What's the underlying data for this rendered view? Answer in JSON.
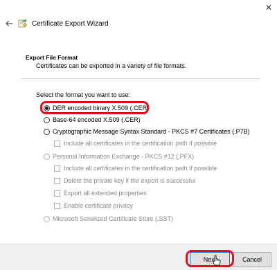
{
  "window": {
    "close_glyph": "✕"
  },
  "titlebar": {
    "back_icon": "back-arrow-icon",
    "title": "Certificate Export Wizard"
  },
  "header": {
    "section_title": "Export File Format",
    "description": "Certificates can be exported in a variety of file formats."
  },
  "form": {
    "prompt": "Select the format you want to use:",
    "options": [
      {
        "label": "DER encoded binary X.509 (.CER)",
        "selected": true,
        "enabled": true
      },
      {
        "label": "Base-64 encoded X.509 (.CER)",
        "selected": false,
        "enabled": true
      },
      {
        "label": "Cryptographic Message Syntax Standard - PKCS #7 Certificates (.P7B)",
        "selected": false,
        "enabled": true
      },
      {
        "label": "Personal Information Exchange - PKCS #12 (.PFX)",
        "selected": false,
        "enabled": false
      },
      {
        "label": "Microsoft Serialized Certificate Store (.SST)",
        "selected": false,
        "enabled": false
      }
    ],
    "p7b_checkboxes": [
      {
        "label": "Include all certificates in the certification path if possible",
        "checked": false,
        "enabled": false
      }
    ],
    "pfx_checkboxes": [
      {
        "label": "Include all certificates in the certification path if possible",
        "checked": false,
        "enabled": false
      },
      {
        "label": "Delete the private key if the export is successful",
        "checked": false,
        "enabled": false
      },
      {
        "label": "Export all extended properties",
        "checked": false,
        "enabled": false
      },
      {
        "label": "Enable certificate privacy",
        "checked": false,
        "enabled": false
      }
    ]
  },
  "footer": {
    "next_label": "Next",
    "cancel_label": "Cancel"
  },
  "annotations": {
    "highlight_color": "#e0121b"
  }
}
